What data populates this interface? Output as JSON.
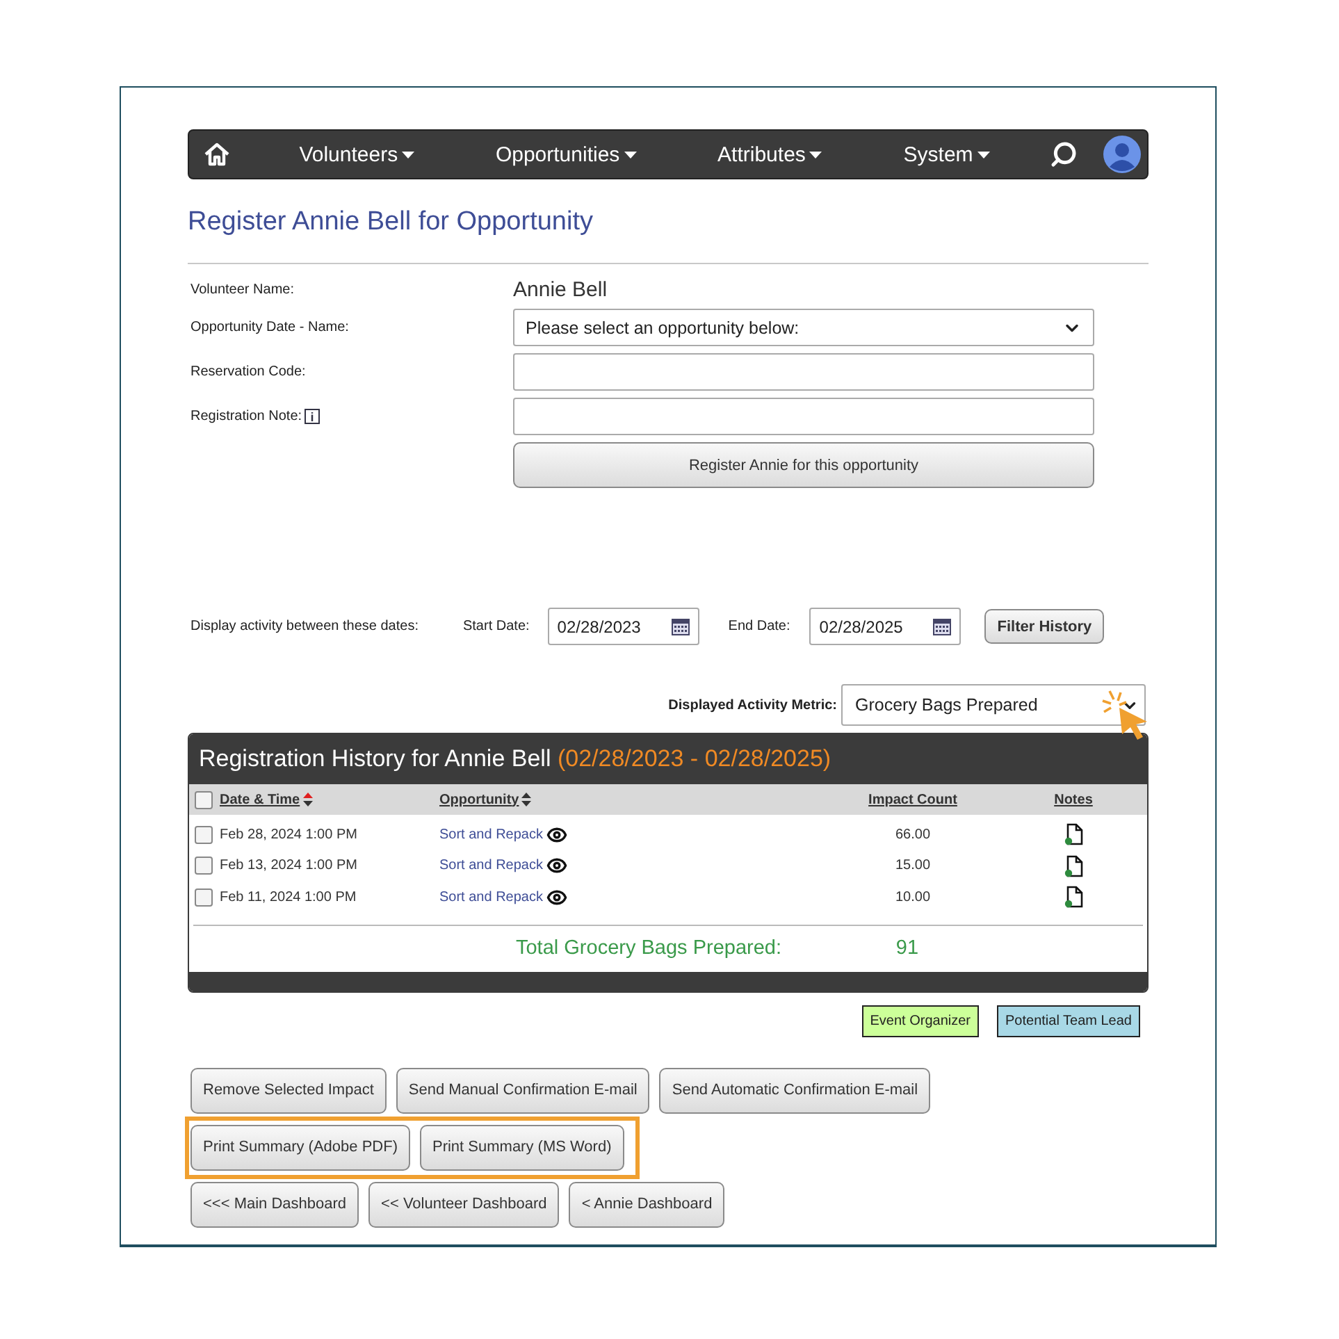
{
  "nav": {
    "items": [
      {
        "label": "Volunteers"
      },
      {
        "label": "Opportunities"
      },
      {
        "label": "Attributes"
      },
      {
        "label": "System"
      }
    ]
  },
  "title": "Register Annie Bell for Opportunity",
  "form": {
    "volunteer_label": "Volunteer Name:",
    "volunteer_name": "Annie Bell",
    "opportunity_label": "Opportunity Date - Name:",
    "opportunity_value": "Please select an opportunity below:",
    "reservation_label": "Reservation Code:",
    "note_label": "Registration Note:",
    "note_info": "i",
    "register_button": "Register Annie for this opportunity"
  },
  "filter": {
    "label": "Display activity between these dates:",
    "start_label": "Start Date:",
    "start_value": "02/28/2023",
    "end_label": "End Date:",
    "end_value": "02/28/2025",
    "button": "Filter History"
  },
  "metric": {
    "label": "Displayed Activity Metric:",
    "value": "Grocery Bags Prepared"
  },
  "history": {
    "title": "Registration History for Annie Bell",
    "range": "(02/28/2023 - 02/28/2025)",
    "select_all_checked": false,
    "columns": [
      {
        "label": "Date & Time",
        "sorted": true
      },
      {
        "label": "Opportunity",
        "sorted": false
      },
      {
        "label": "Impact Count"
      },
      {
        "label": "Notes"
      }
    ],
    "rows": [
      {
        "checked": false,
        "date": "Feb 28, 2024 1:00 PM",
        "opportunity": "Sort and Repack",
        "impact": "66.00"
      },
      {
        "checked": false,
        "date": "Feb 13, 2024 1:00 PM",
        "opportunity": "Sort and Repack",
        "impact": "15.00"
      },
      {
        "checked": false,
        "date": "Feb 11, 2024 1:00 PM",
        "opportunity": "Sort and Repack",
        "impact": "10.00"
      }
    ],
    "total_label": "Total Grocery Bags Prepared:",
    "total_value": "91"
  },
  "tags": [
    {
      "label": "Event Organizer",
      "color": "#ccff99"
    },
    {
      "label": "Potential Team Lead",
      "color": "#a8d8e6"
    }
  ],
  "button_rows": [
    {
      "highlighted": false,
      "buttons": [
        "Remove Selected Impact",
        "Send Manual Confirmation E-mail",
        "Send Automatic Confirmation E-mail"
      ]
    },
    {
      "highlighted": true,
      "buttons": [
        "Print Summary (Adobe PDF)",
        "Print Summary (MS Word)"
      ]
    },
    {
      "highlighted": false,
      "buttons": [
        "<<< Main Dashboard",
        "<< Volunteer Dashboard",
        "< Annie Dashboard"
      ]
    }
  ]
}
